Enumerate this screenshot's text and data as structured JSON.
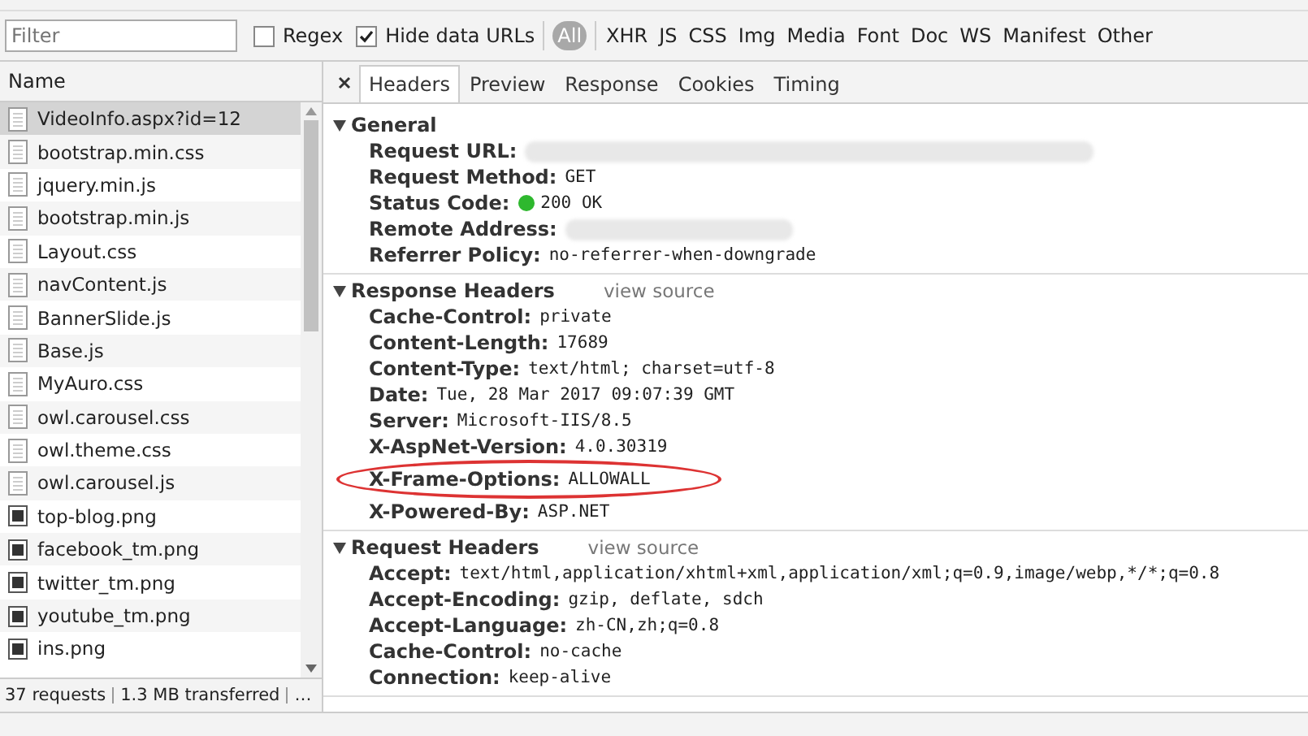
{
  "filter_bar": {
    "filter": {
      "placeholder": "Filter"
    },
    "checkboxes": [
      {
        "label": "Regex",
        "checked": false
      },
      {
        "label": "Hide data URLs",
        "checked": true
      }
    ],
    "types": [
      {
        "label": "All",
        "selected": true
      },
      {
        "label": "XHR",
        "selected": false
      },
      {
        "label": "JS",
        "selected": false
      },
      {
        "label": "CSS",
        "selected": false
      },
      {
        "label": "Img",
        "selected": false
      },
      {
        "label": "Media",
        "selected": false
      },
      {
        "label": "Font",
        "selected": false
      },
      {
        "label": "Doc",
        "selected": false
      },
      {
        "label": "WS",
        "selected": false
      },
      {
        "label": "Manifest",
        "selected": false
      },
      {
        "label": "Other",
        "selected": false
      }
    ]
  },
  "requests": {
    "column": "Name",
    "rows": [
      {
        "name": "VideoInfo.aspx?id=12",
        "kind": "document",
        "selected": true
      },
      {
        "name": "bootstrap.min.css",
        "kind": "document",
        "selected": false
      },
      {
        "name": "jquery.min.js",
        "kind": "document",
        "selected": false
      },
      {
        "name": "bootstrap.min.js",
        "kind": "document",
        "selected": false
      },
      {
        "name": "Layout.css",
        "kind": "document",
        "selected": false
      },
      {
        "name": "navContent.js",
        "kind": "document",
        "selected": false
      },
      {
        "name": "BannerSlide.js",
        "kind": "document",
        "selected": false
      },
      {
        "name": "Base.js",
        "kind": "document",
        "selected": false
      },
      {
        "name": "MyAuro.css",
        "kind": "document",
        "selected": false
      },
      {
        "name": "owl.carousel.css",
        "kind": "document",
        "selected": false
      },
      {
        "name": "owl.theme.css",
        "kind": "document",
        "selected": false
      },
      {
        "name": "owl.carousel.js",
        "kind": "document",
        "selected": false
      },
      {
        "name": "top-blog.png",
        "kind": "image",
        "selected": false
      },
      {
        "name": "facebook_tm.png",
        "kind": "image",
        "selected": false
      },
      {
        "name": "twitter_tm.png",
        "kind": "image",
        "selected": false
      },
      {
        "name": "youtube_tm.png",
        "kind": "image",
        "selected": false
      },
      {
        "name": "ins.png",
        "kind": "image",
        "selected": false
      }
    ],
    "status": "37 requests",
    "transferred": "1.3 MB transferred",
    "more": "…"
  },
  "detail": {
    "tabs": [
      {
        "label": "Headers",
        "selected": true
      },
      {
        "label": "Preview",
        "selected": false
      },
      {
        "label": "Response",
        "selected": false
      },
      {
        "label": "Cookies",
        "selected": false
      },
      {
        "label": "Timing",
        "selected": false
      }
    ],
    "sections": [
      {
        "title": "General",
        "expanded": true,
        "items": [
          {
            "key": "Request URL:",
            "kind": "redacted"
          },
          {
            "key": "Request Method:",
            "value": "GET",
            "kind": "text"
          },
          {
            "key": "Status Code:",
            "value": "200 OK",
            "kind": "status"
          },
          {
            "key": "Remote Address:",
            "kind": "redacted"
          },
          {
            "key": "Referrer Policy:",
            "value": "no-referrer-when-downgrade",
            "kind": "text"
          }
        ]
      },
      {
        "title": "Response Headers",
        "link": "view source",
        "expanded": true,
        "items": [
          {
            "key": "Cache-Control:",
            "value": "private",
            "kind": "text"
          },
          {
            "key": "Content-Length:",
            "value": "17689",
            "kind": "text"
          },
          {
            "key": "Content-Type:",
            "value": "text/html; charset=utf-8",
            "kind": "text"
          },
          {
            "key": "Date:",
            "value": "Tue, 28 Mar 2017 09:07:39 GMT",
            "kind": "text"
          },
          {
            "key": "Server:",
            "value": "Microsoft-IIS/8.5",
            "kind": "text"
          },
          {
            "key": "X-AspNet-Version:",
            "value": "4.0.30319",
            "kind": "text"
          },
          {
            "key": "X-Frame-Options:",
            "value": "ALLOWALL",
            "kind": "text",
            "highlighted": true
          },
          {
            "key": "X-Powered-By:",
            "value": "ASP.NET",
            "kind": "text"
          }
        ]
      },
      {
        "title": "Request Headers",
        "link": "view source",
        "expanded": true,
        "items": [
          {
            "key": "Accept:",
            "value": "text/html,application/xhtml+xml,application/xml;q=0.9,image/webp,*/*;q=0.8",
            "kind": "text"
          },
          {
            "key": "Accept-Encoding:",
            "value": "gzip, deflate, sdch",
            "kind": "text"
          },
          {
            "key": "Accept-Language:",
            "value": "zh-CN,zh;q=0.8",
            "kind": "text"
          },
          {
            "key": "Cache-Control:",
            "value": "no-cache",
            "kind": "text"
          },
          {
            "key": "Connection:",
            "value": "keep-alive",
            "kind": "text"
          }
        ]
      }
    ]
  }
}
